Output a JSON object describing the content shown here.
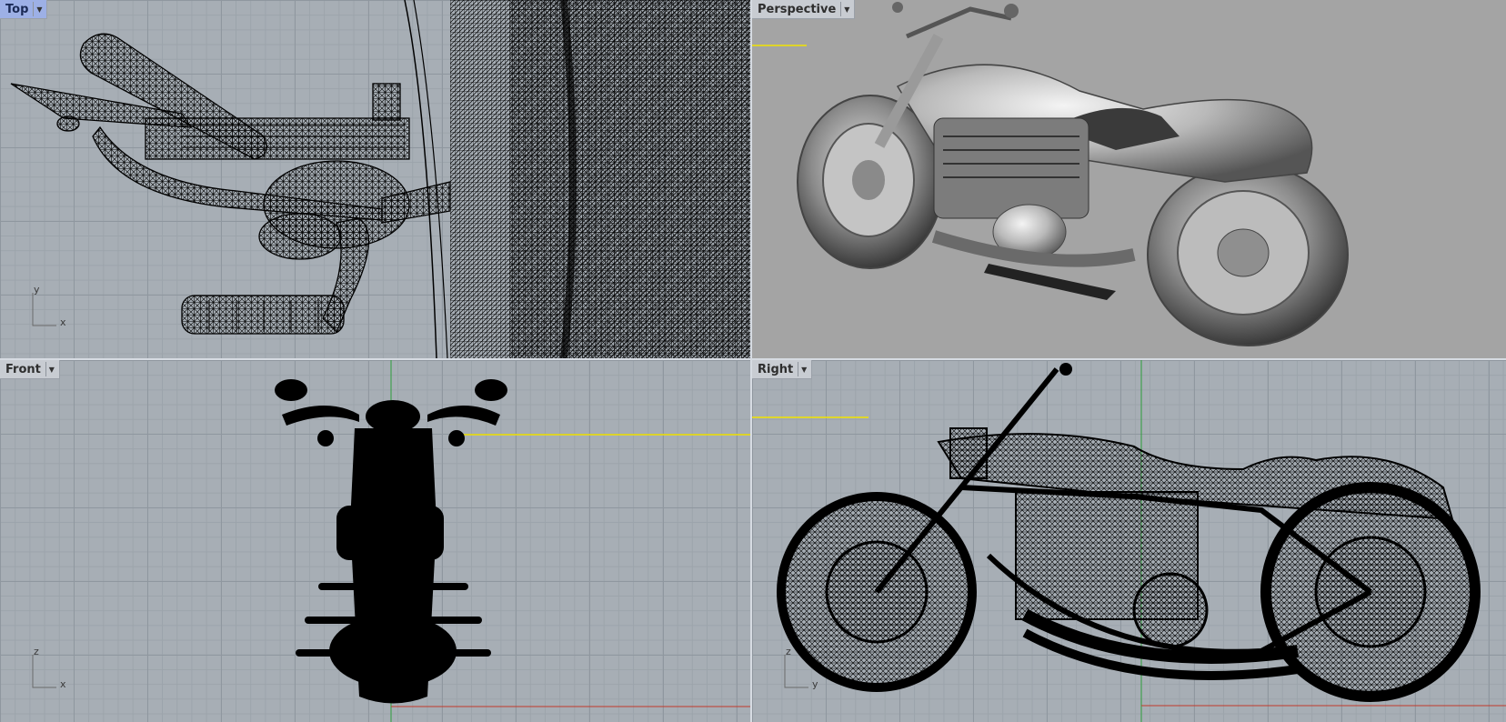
{
  "viewports": {
    "top": {
      "label": "Top",
      "axis_a": "y",
      "axis_b": "x"
    },
    "perspective": {
      "label": "Perspective"
    },
    "front": {
      "label": "Front",
      "axis_a": "z",
      "axis_b": "x"
    },
    "right": {
      "label": "Right",
      "axis_a": "z",
      "axis_b": "y"
    }
  },
  "icons": {
    "dropdown": "chevron-down-icon"
  },
  "colors": {
    "viewport_bg": "#a7aeb5",
    "perspective_bg": "#a4a4a4",
    "active_tab": "#9db0e6",
    "x_axis": "#c0392b",
    "y_axis": "#2e9e3a",
    "highlight": "#f2e400"
  }
}
